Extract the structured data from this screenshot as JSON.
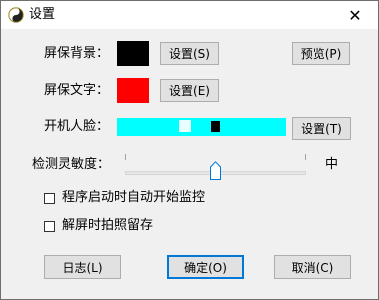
{
  "window": {
    "title": "设置",
    "close_glyph": "✕"
  },
  "screensaver_bg": {
    "label": "屏保背景：",
    "color": "#000000",
    "button": "设置(S)"
  },
  "screensaver_text": {
    "label": "屏保文字：",
    "color": "#ff0000",
    "button": "设置(E)"
  },
  "face": {
    "label": "开机人脸：",
    "button": "设置(T)",
    "color": "#00ffff"
  },
  "preview_button": "预览(P)",
  "sensitivity": {
    "label": "检测灵敏度：",
    "level": 0.5,
    "value_label": "中"
  },
  "options": [
    {
      "label": "程序启动时自动开始监控",
      "checked": false
    },
    {
      "label": "解屏时拍照留存",
      "checked": false
    }
  ],
  "footer": {
    "log": "日志(L)",
    "ok": "确定(O)",
    "cancel": "取消(C)"
  },
  "colors": {
    "accent": "#0078d7"
  }
}
